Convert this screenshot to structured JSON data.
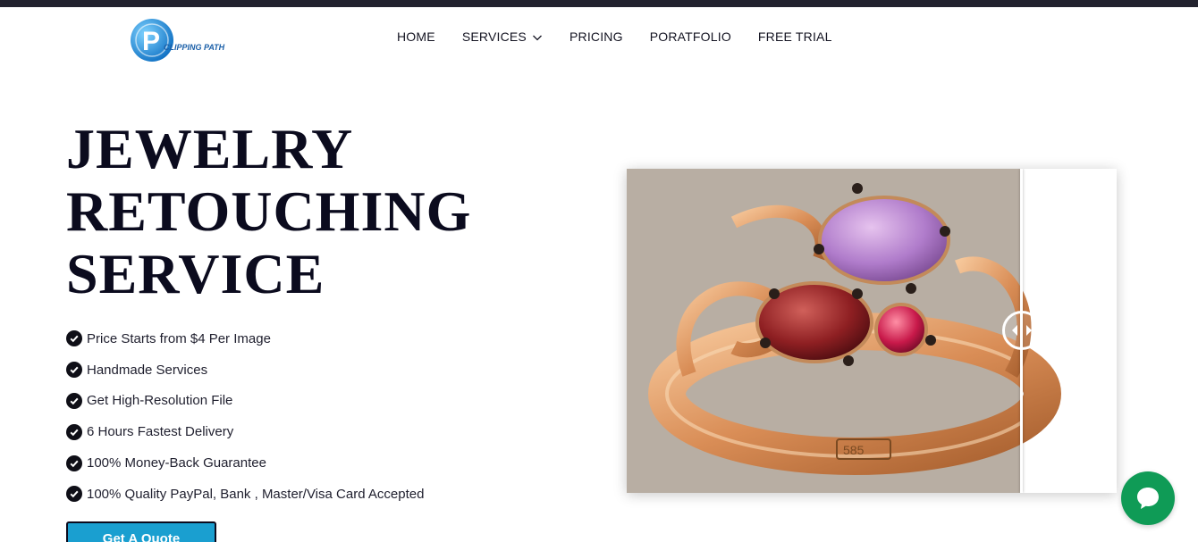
{
  "brand": {
    "logo_text": "CLIPPING PATH",
    "logo_letter": "P",
    "logo_color": "#1e8fd6"
  },
  "nav": {
    "items": [
      {
        "label": "HOME"
      },
      {
        "label": "SERVICES",
        "has_dropdown": true
      },
      {
        "label": "PRICING"
      },
      {
        "label": "PORATFOLIO"
      },
      {
        "label": "FREE TRIAL"
      }
    ]
  },
  "hero": {
    "title_lines": [
      "JEWELRY",
      "RETOUCHING",
      "SERVICE"
    ],
    "features": [
      "Price Starts from $4 Per Image",
      "Handmade Services",
      "Get High-Resolution File",
      "6 Hours Fastest Delivery",
      "100% Money-Back Guarantee",
      "100% Quality PayPal, Bank , Master/Visa Card Accepted"
    ],
    "cta_label": "Get A Quote",
    "cta_color": "#1a9fd0"
  },
  "comparison": {
    "before_background": "#b8aea3",
    "after_background": "#ffffff",
    "slider_position": 0.805,
    "ring_engraving": "585"
  },
  "chat": {
    "icon": "chat-bubble-icon",
    "color": "#0f9b56"
  },
  "colors": {
    "topbar": "#22222e",
    "title": "#0b0b1e"
  }
}
